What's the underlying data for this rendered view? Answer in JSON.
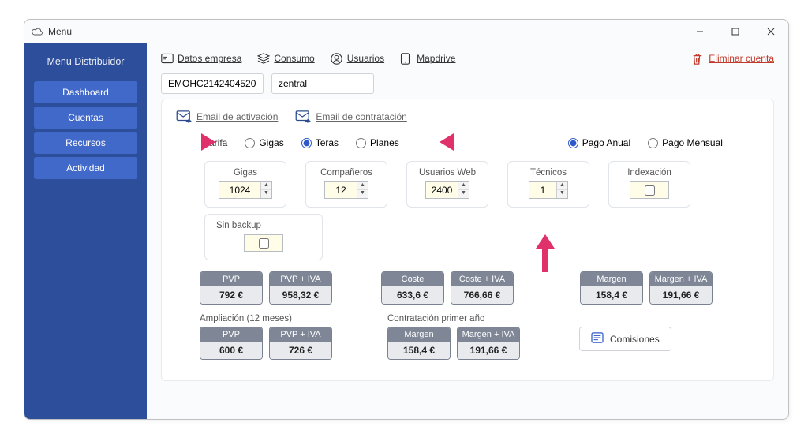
{
  "window": {
    "title": "Menu"
  },
  "sidebar": {
    "title": "Menu Distribuidor",
    "items": [
      "Dashboard",
      "Cuentas",
      "Recursos",
      "Actividad"
    ]
  },
  "topnav": {
    "datos_empresa": "Datos empresa",
    "consumo": "Consumo",
    "usuarios": "Usuarios",
    "mapdrive": "Mapdrive",
    "eliminar": "Eliminar cuenta"
  },
  "ids": {
    "code": "EMOHC2142404520",
    "name": "zentral"
  },
  "emails": {
    "activacion": "Email de activación",
    "contratacion": "Email de contratación"
  },
  "tarifa": {
    "label": "Tarifa",
    "gigas": "Gigas",
    "teras": "Teras",
    "planes": "Planes",
    "pago_anual": "Pago Anual",
    "pago_mensual": "Pago Mensual"
  },
  "fields": {
    "gigas": {
      "label": "Gigas",
      "value": "1024"
    },
    "companeros": {
      "label": "Compañeros",
      "value": "12"
    },
    "usuarios_web": {
      "label": "Usuarios Web",
      "value": "2400"
    },
    "tecnicos": {
      "label": "Técnicos",
      "value": "1"
    },
    "indexacion": {
      "label": "Indexación"
    },
    "sin_backup": {
      "label": "Sin backup"
    }
  },
  "prices": {
    "row1": {
      "pvp": {
        "h": "PVP",
        "v": "792 €"
      },
      "pvp_iva": {
        "h": "PVP + IVA",
        "v": "958,32 €"
      },
      "coste": {
        "h": "Coste",
        "v": "633,6 €"
      },
      "coste_iva": {
        "h": "Coste + IVA",
        "v": "766,66 €"
      },
      "margen": {
        "h": "Margen",
        "v": "158,4 €"
      },
      "margen_iva": {
        "h": "Margen + IVA",
        "v": "191,66 €"
      }
    },
    "ampliacion_label": "Ampliación (12 meses)",
    "contratacion_label": "Contratación primer año",
    "row2": {
      "pvp": {
        "h": "PVP",
        "v": "600 €"
      },
      "pvp_iva": {
        "h": "PVP + IVA",
        "v": "726 €"
      },
      "margen": {
        "h": "Margen",
        "v": "158,4 €"
      },
      "margen_iva": {
        "h": "Margen + IVA",
        "v": "191,66 €"
      }
    }
  },
  "comisiones": "Comisiones"
}
